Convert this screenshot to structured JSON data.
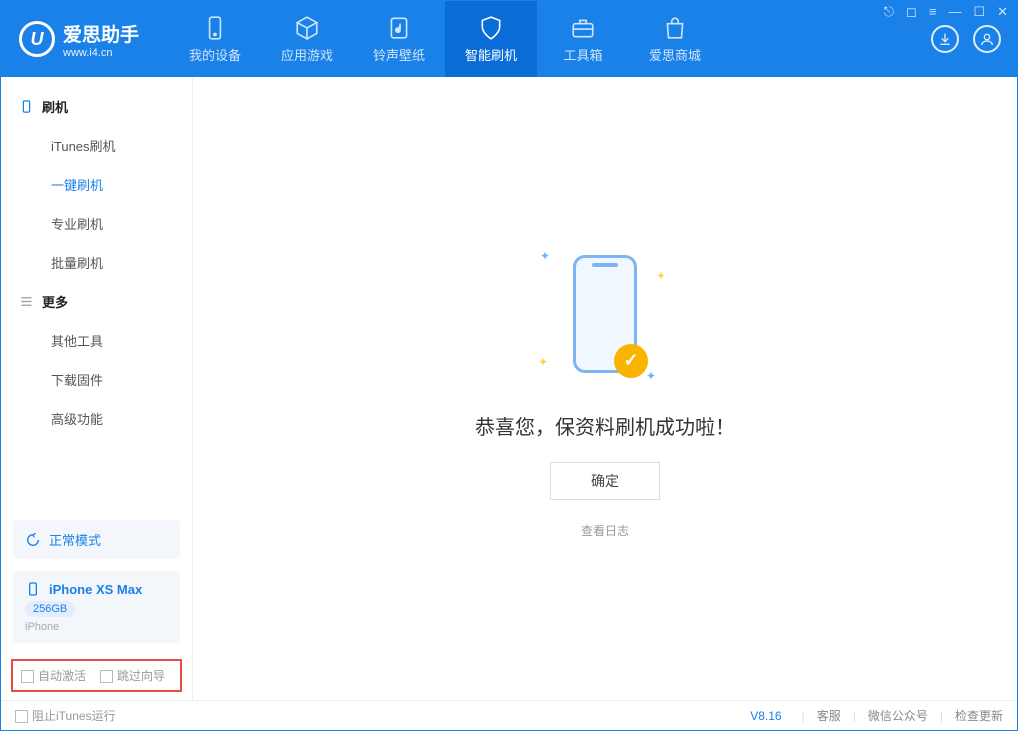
{
  "app": {
    "name": "爱思助手",
    "site": "www.i4.cn"
  },
  "nav": [
    {
      "label": "我的设备"
    },
    {
      "label": "应用游戏"
    },
    {
      "label": "铃声壁纸"
    },
    {
      "label": "智能刷机"
    },
    {
      "label": "工具箱"
    },
    {
      "label": "爱思商城"
    }
  ],
  "sidebar": {
    "group1": "刷机",
    "items1": [
      "iTunes刷机",
      "一键刷机",
      "专业刷机",
      "批量刷机"
    ],
    "group2": "更多",
    "items2": [
      "其他工具",
      "下载固件",
      "高级功能"
    ]
  },
  "device": {
    "mode": "正常模式",
    "name": "iPhone XS Max",
    "capacity": "256GB",
    "type": "iPhone"
  },
  "options": {
    "auto_activate": "自动激活",
    "skip_guide": "跳过向导"
  },
  "main": {
    "success": "恭喜您，保资料刷机成功啦！",
    "ok": "确定",
    "view_log": "查看日志"
  },
  "status": {
    "block_itunes": "阻止iTunes运行",
    "version": "V8.16",
    "links": [
      "客服",
      "微信公众号",
      "检查更新"
    ]
  }
}
